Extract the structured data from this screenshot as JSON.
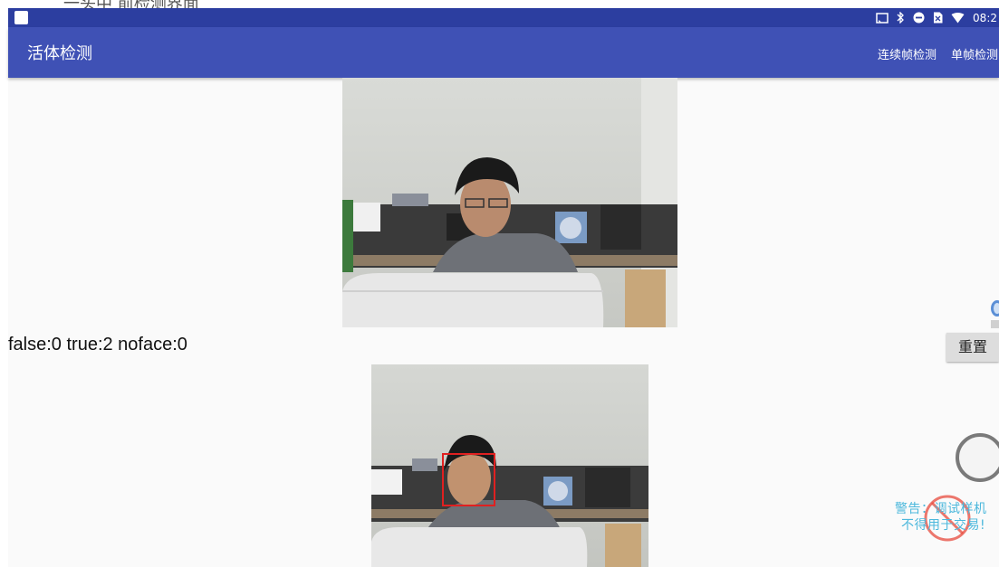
{
  "window": {
    "top_strip_text": "一头中 前检测界面"
  },
  "status_bar": {
    "time": "08:2",
    "icons": [
      "cast-icon",
      "bluetooth-icon",
      "do-not-disturb-icon",
      "sim-card-icon",
      "wifi-icon"
    ]
  },
  "app_bar": {
    "title": "活体检测",
    "menu": {
      "continuous_label": "连续帧检测",
      "single_label": "单帧检测"
    }
  },
  "detection": {
    "stats_text": "false:0 true:2 noface:0"
  },
  "controls": {
    "reset_label": "重置"
  },
  "watermark": {
    "line1": "警告：调试样机",
    "line2": "不得用于交易!"
  },
  "colors": {
    "status_bar": "#2c3ea0",
    "app_bar": "#3f51b5",
    "face_box": "#e02020",
    "warning_text": "#4cb8dc"
  }
}
